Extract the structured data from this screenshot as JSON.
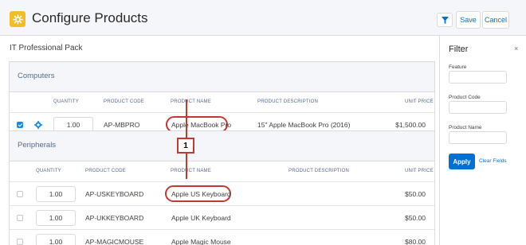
{
  "header": {
    "title": "Configure Products",
    "save_label": "Save",
    "cancel_label": "Cancel",
    "icons": [
      "configure-icon",
      "filter-icon"
    ]
  },
  "bundle": {
    "name": "IT Professional Pack"
  },
  "groups": [
    {
      "name": "Computers",
      "columns": {
        "quantity": "QUANTITY",
        "code": "PRODUCT CODE",
        "name": "PRODUCT NAME",
        "description": "PRODUCT DESCRIPTION",
        "price": "UNIT PRICE"
      },
      "rows": [
        {
          "selected": true,
          "quantity": "1.00",
          "code": "AP-MBPRO",
          "name": "Apple MacBook Pro",
          "description": "15\" Apple MacBook Pro (2016)",
          "price": "$1,500.00"
        }
      ]
    },
    {
      "name": "Peripherals",
      "columns": {
        "quantity": "QUANTITY",
        "code": "PRODUCT CODE",
        "name": "PRODUCT NAME",
        "description": "PRODUCT DESCRIPTION",
        "price": "UNIT PRICE"
      },
      "rows": [
        {
          "selected": false,
          "quantity": "1.00",
          "code": "AP-USKEYBOARD",
          "name": "Apple US Keyboard",
          "description": "",
          "price": "$50.00"
        },
        {
          "selected": false,
          "quantity": "1.00",
          "code": "AP-UKKEYBOARD",
          "name": "Apple UK Keyboard",
          "description": "",
          "price": "$50.00"
        },
        {
          "selected": false,
          "quantity": "1.00",
          "code": "AP-MAGICMOUSE",
          "name": "Apple Magic Mouse",
          "description": "",
          "price": "$80.00"
        }
      ]
    }
  ],
  "callout": {
    "number": "1"
  },
  "filter": {
    "title": "Filter",
    "close": "×",
    "fields": [
      {
        "label": "Feature",
        "value": ""
      },
      {
        "label": "Product Code",
        "value": ""
      },
      {
        "label": "Product Name",
        "value": ""
      }
    ],
    "apply_label": "Apply",
    "clear_label": "Clear Fields"
  },
  "colors": {
    "accent": "#0070d2",
    "highlight": "#c23934",
    "app_icon": "#f4bc25"
  }
}
